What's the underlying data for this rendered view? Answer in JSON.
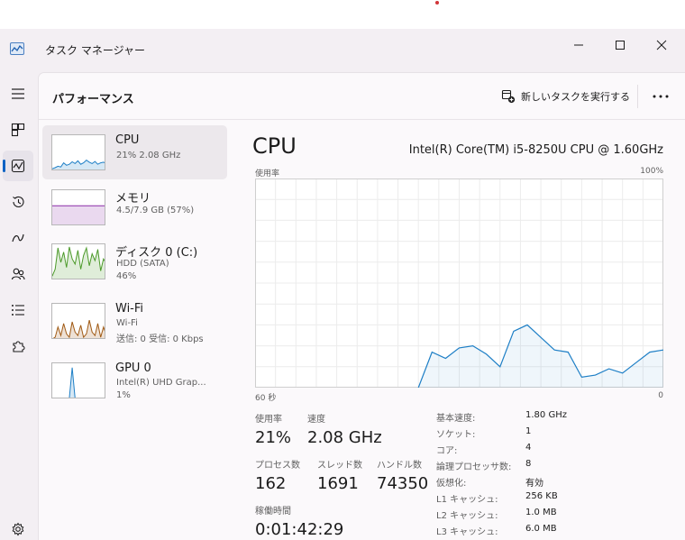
{
  "window": {
    "title": "タスク マネージャー",
    "app_icon": "performance-chart-icon"
  },
  "nav": {
    "items": [
      {
        "icon": "hamburger-menu-icon"
      },
      {
        "icon": "processes-grid-icon"
      },
      {
        "icon": "performance-icon",
        "active": true
      },
      {
        "icon": "app-history-icon"
      },
      {
        "icon": "startup-apps-icon"
      },
      {
        "icon": "users-icon"
      },
      {
        "icon": "details-list-icon"
      },
      {
        "icon": "services-puzzle-icon"
      },
      {
        "icon": "settings-gear-icon"
      }
    ]
  },
  "header": {
    "title": "パフォーマンス",
    "new_task_label": "新しいタスクを実行する",
    "more_icon": "more-options-icon"
  },
  "devices": [
    {
      "name": "CPU",
      "line1": "21%  2.08 GHz",
      "line2": "",
      "selected": true,
      "color": "#1e7fc6",
      "graph": [
        0.05,
        0.08,
        0.12,
        0.1,
        0.22,
        0.15,
        0.18,
        0.25,
        0.2,
        0.28,
        0.18,
        0.22,
        0.3,
        0.24,
        0.2,
        0.26,
        0.18,
        0.22,
        0.24,
        0.2
      ]
    },
    {
      "name": "メモリ",
      "line1": "4.5/7.9 GB (57%)",
      "line2": "",
      "selected": false,
      "color": "#8b2fa8",
      "graph": [
        0.57,
        0.57,
        0.57,
        0.57,
        0.57,
        0.57,
        0.57,
        0.57,
        0.57,
        0.57,
        0.57,
        0.57,
        0.57,
        0.57,
        0.57,
        0.57,
        0.57,
        0.57,
        0.57,
        0.57
      ]
    },
    {
      "name": "ディスク 0 (C:)",
      "line1": "HDD (SATA)",
      "line2": "46%",
      "selected": false,
      "color": "#4c9a2a",
      "graph": [
        0.1,
        0.3,
        0.92,
        0.5,
        0.8,
        0.35,
        0.95,
        0.6,
        0.45,
        0.85,
        0.3,
        0.7,
        0.92,
        0.4,
        0.75,
        0.55,
        0.88,
        0.25,
        0.6,
        0.46
      ]
    },
    {
      "name": "Wi-Fi",
      "line1": "Wi-Fi",
      "line2": "送信: 0  受信: 0 Kbps",
      "selected": false,
      "color": "#a05a14",
      "graph": [
        0.0,
        0.05,
        0.35,
        0.1,
        0.45,
        0.15,
        0.05,
        0.5,
        0.2,
        0.1,
        0.4,
        0.05,
        0.15,
        0.55,
        0.2,
        0.1,
        0.45,
        0.05,
        0.35,
        0.1
      ]
    },
    {
      "name": "GPU 0",
      "line1": "Intel(R) UHD Grap...",
      "line2": "1%",
      "selected": false,
      "color": "#1e7fc6",
      "graph": [
        0.0,
        0.0,
        0.0,
        0.0,
        0.0,
        0.0,
        0.0,
        0.9,
        0.0,
        0.0,
        0.0,
        0.0,
        0.0,
        0.0,
        0.0,
        0.0,
        0.0,
        0.0,
        0.0,
        0.01
      ]
    }
  ],
  "cpu": {
    "title": "CPU",
    "model": "Intel(R) Core(TM) i5-8250U CPU @ 1.60GHz",
    "graph_label": "使用率",
    "graph_max_label": "100%",
    "time_left_label": "60 秒",
    "time_right_label": "0",
    "stats": {
      "usage_label": "使用率",
      "usage": "21%",
      "speed_label": "速度",
      "speed": "2.08 GHz",
      "processes_label": "プロセス数",
      "processes": "162",
      "threads_label": "スレッド数",
      "threads": "1691",
      "handles_label": "ハンドル数",
      "handles": "74350",
      "uptime_label": "稼働時間",
      "uptime": "0:01:42:29"
    },
    "specs": [
      {
        "label": "基本速度:",
        "value": "1.80 GHz"
      },
      {
        "label": "ソケット:",
        "value": "1"
      },
      {
        "label": "コア:",
        "value": "4"
      },
      {
        "label": "論理プロセッサ数:",
        "value": "8"
      },
      {
        "label": "仮想化:",
        "value": "有効"
      },
      {
        "label": "L1 キャッシュ:",
        "value": "256 KB"
      },
      {
        "label": "L2 キャッシュ:",
        "value": "1.0 MB"
      },
      {
        "label": "L3 キャッシュ:",
        "value": "6.0 MB"
      }
    ]
  },
  "chart_data": {
    "type": "area",
    "x": [
      60,
      58,
      56,
      54,
      52,
      50,
      48,
      46,
      44,
      42,
      40,
      38,
      36,
      34,
      32,
      30,
      28,
      26,
      24,
      22,
      20,
      18,
      16,
      14,
      12,
      10,
      8,
      6,
      4,
      2,
      0
    ],
    "values": [
      null,
      null,
      null,
      null,
      null,
      null,
      null,
      null,
      null,
      null,
      null,
      null,
      0,
      17,
      14,
      19,
      20,
      16,
      10,
      27,
      30,
      24,
      18,
      17,
      5,
      6,
      9,
      7,
      12,
      17,
      18
    ],
    "ylim": [
      0,
      100
    ],
    "xlabel_left": "60 秒",
    "xlabel_right": "0",
    "ylabel": "使用率",
    "ymax_label": "100%",
    "grid": true,
    "color": "#1e7fc6"
  }
}
